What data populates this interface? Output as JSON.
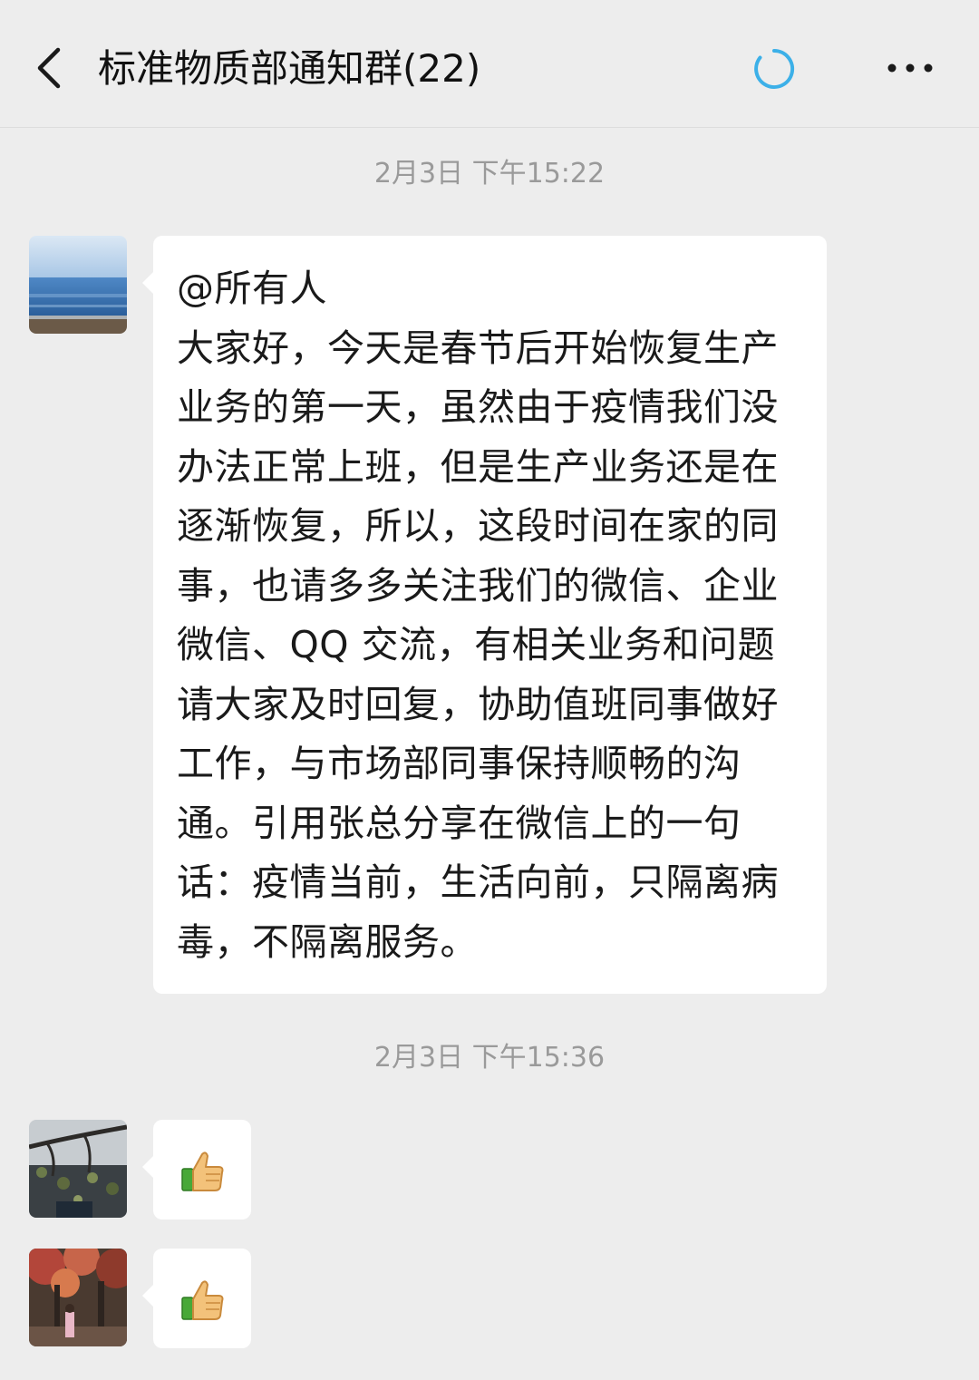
{
  "header": {
    "title": "标准物质部通知群(22)",
    "back_icon": "chevron-left-icon",
    "status_icon": "loading-spinner-icon",
    "more_icon": "more-dots-icon"
  },
  "messages": [
    {
      "timestamp": "2月3日 下午15:22",
      "text": "@所有人\n大家好，今天是春节后开始恢复生产业务的第一天，虽然由于疫情我们没办法正常上班，但是生产业务还是在逐渐恢复，所以，这段时间在家的同事，也请多多关注我们的微信、企业微信、QQ 交流，有相关业务和问题请大家及时回复，协助值班同事做好工作，与市场部同事保持顺畅的沟通。引用张总分享在微信上的一句话：疫情当前，生活向前，只隔离病毒，不隔离服务。"
    },
    {
      "timestamp": "2月3日 下午15:36",
      "emoji": "thumbs-up-icon"
    },
    {
      "emoji": "thumbs-up-icon"
    }
  ],
  "colors": {
    "background": "#ededed",
    "bubble": "#ffffff",
    "timestamp": "#9a9a9a",
    "spinner": "#3cb0e8"
  }
}
